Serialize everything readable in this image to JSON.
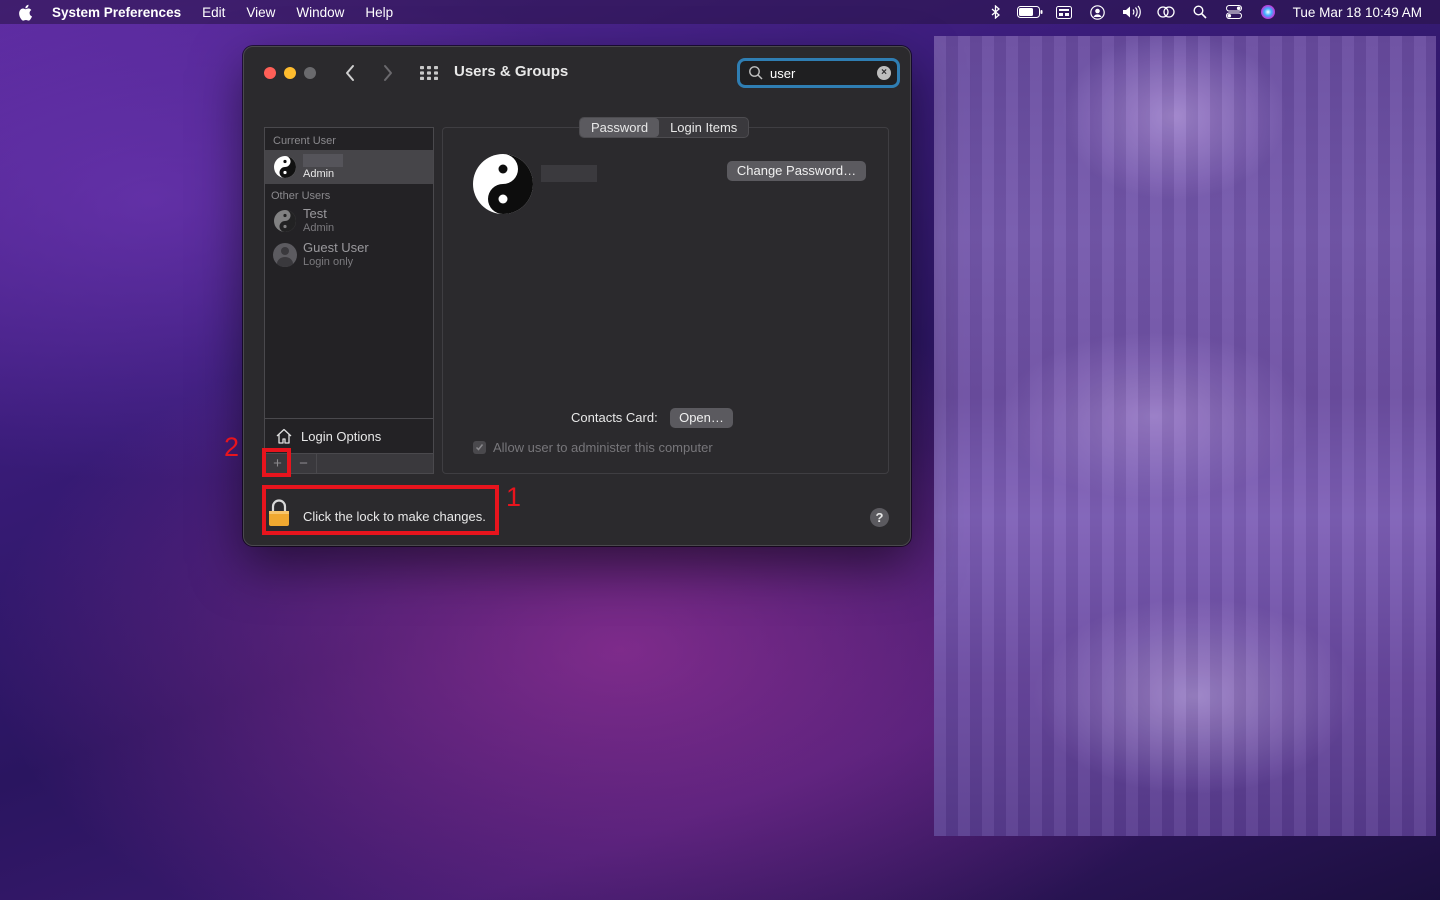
{
  "menubar": {
    "apple_icon": "apple-logo-icon",
    "app_name": "System Preferences",
    "menus": [
      "Edit",
      "View",
      "Window",
      "Help"
    ],
    "status_icons": [
      "bluetooth-icon",
      "battery-icon",
      "input-menu-icon",
      "user-account-icon",
      "volume-icon",
      "screen-mirroring-icon",
      "spotlight-icon",
      "control-center-icon",
      "siri-icon"
    ],
    "clock": "Tue Mar 18  10:49 AM"
  },
  "window": {
    "title": "Users & Groups",
    "search": {
      "value": "user"
    }
  },
  "sidebar": {
    "current_user_label": "Current User",
    "current_user": {
      "name": "",
      "role": "Admin"
    },
    "other_users_label": "Other Users",
    "other_users": [
      {
        "name": "Test",
        "role": "Admin"
      },
      {
        "name": "Guest User",
        "role": "Login only"
      }
    ],
    "login_options_label": "Login Options",
    "add_symbol": "+",
    "remove_symbol": "−"
  },
  "detail": {
    "tabs": [
      "Password",
      "Login Items"
    ],
    "active_tab": "Password",
    "change_password_label": "Change Password…",
    "contacts_card_label": "Contacts Card:",
    "open_label": "Open…",
    "admin_checkbox_label": "Allow user to administer this computer",
    "admin_checked": true
  },
  "footer": {
    "lock_text": "Click the lock to make changes.",
    "help_symbol": "?"
  },
  "annotations": {
    "one": "1",
    "two": "2",
    "color": "#e8141d"
  },
  "colors": {
    "search_focus": "#2f7eb3",
    "close": "#ff5f57",
    "minimize": "#febc2e",
    "lock": "#f0a830"
  }
}
